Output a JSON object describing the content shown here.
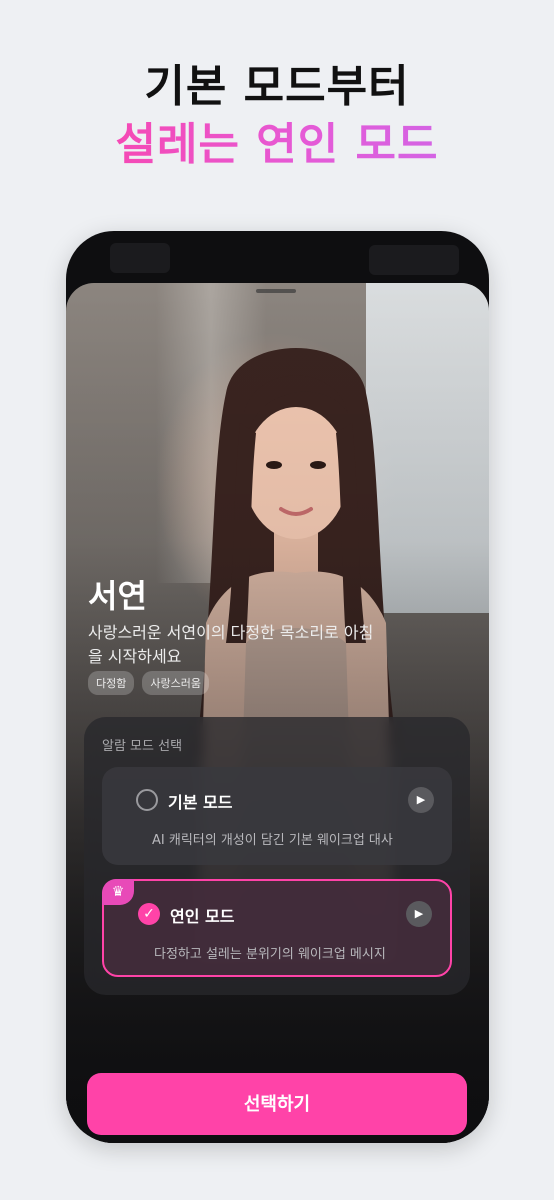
{
  "promo": {
    "line1": "기본 모드부터",
    "line2": "설레는 연인 모드"
  },
  "character": {
    "name": "서연",
    "description": "사랑스러운 서연이의 다정한 목소리로 아침을 시작하세요",
    "tags": [
      "다정함",
      "사랑스러움"
    ]
  },
  "modes": {
    "panel_title": "알람 모드 선택",
    "items": [
      {
        "title": "기본 모드",
        "subtitle": "AI 캐릭터의 개성이 담긴 기본 웨이크업 대사",
        "selected": false,
        "premium": false
      },
      {
        "title": "연인 모드",
        "subtitle": "다정하고 설레는 분위기의 웨이크업 메시지",
        "selected": true,
        "premium": true
      }
    ]
  },
  "action": {
    "select_label": "선택하기"
  },
  "colors": {
    "accent": "#ff43a8",
    "gradient_end": "#c56cf0",
    "background": "#eef0f3"
  },
  "icons": {
    "play": "play-icon",
    "check": "check-icon",
    "crown": "crown-icon"
  }
}
